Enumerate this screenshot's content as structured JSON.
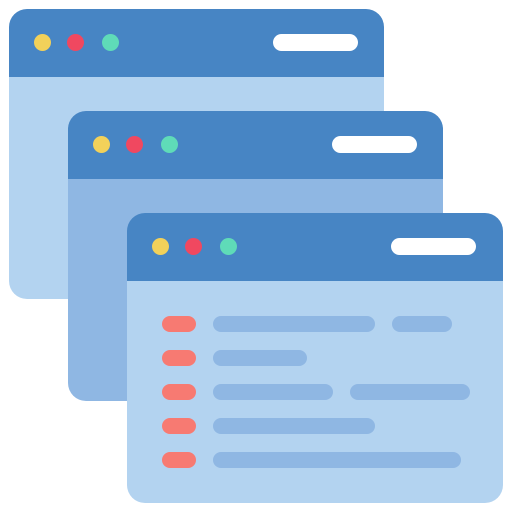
{
  "colors": {
    "titlebar": "#4785C4",
    "body_back": "#B3D3F0",
    "body_middle": "#8FB7E3",
    "body_front": "#B3D3F0",
    "dot_yellow": "#F2D15A",
    "dot_red": "#F04860",
    "dot_teal": "#5FDBB8",
    "address_bar": "#FFFFFF",
    "list_bullet": "#F77A72",
    "list_line": "#8FB7E3"
  },
  "icons": {
    "window_controls": [
      "minimize-dot-icon",
      "close-dot-icon",
      "maximize-dot-icon"
    ],
    "bullet": "list-bullet-icon"
  },
  "front_window": {
    "rows": [
      {
        "bullet": true,
        "lines": 2
      },
      {
        "bullet": true,
        "lines": 1
      },
      {
        "bullet": true,
        "lines": 2
      },
      {
        "bullet": true,
        "lines": 1
      },
      {
        "bullet": true,
        "lines": 1
      }
    ]
  }
}
